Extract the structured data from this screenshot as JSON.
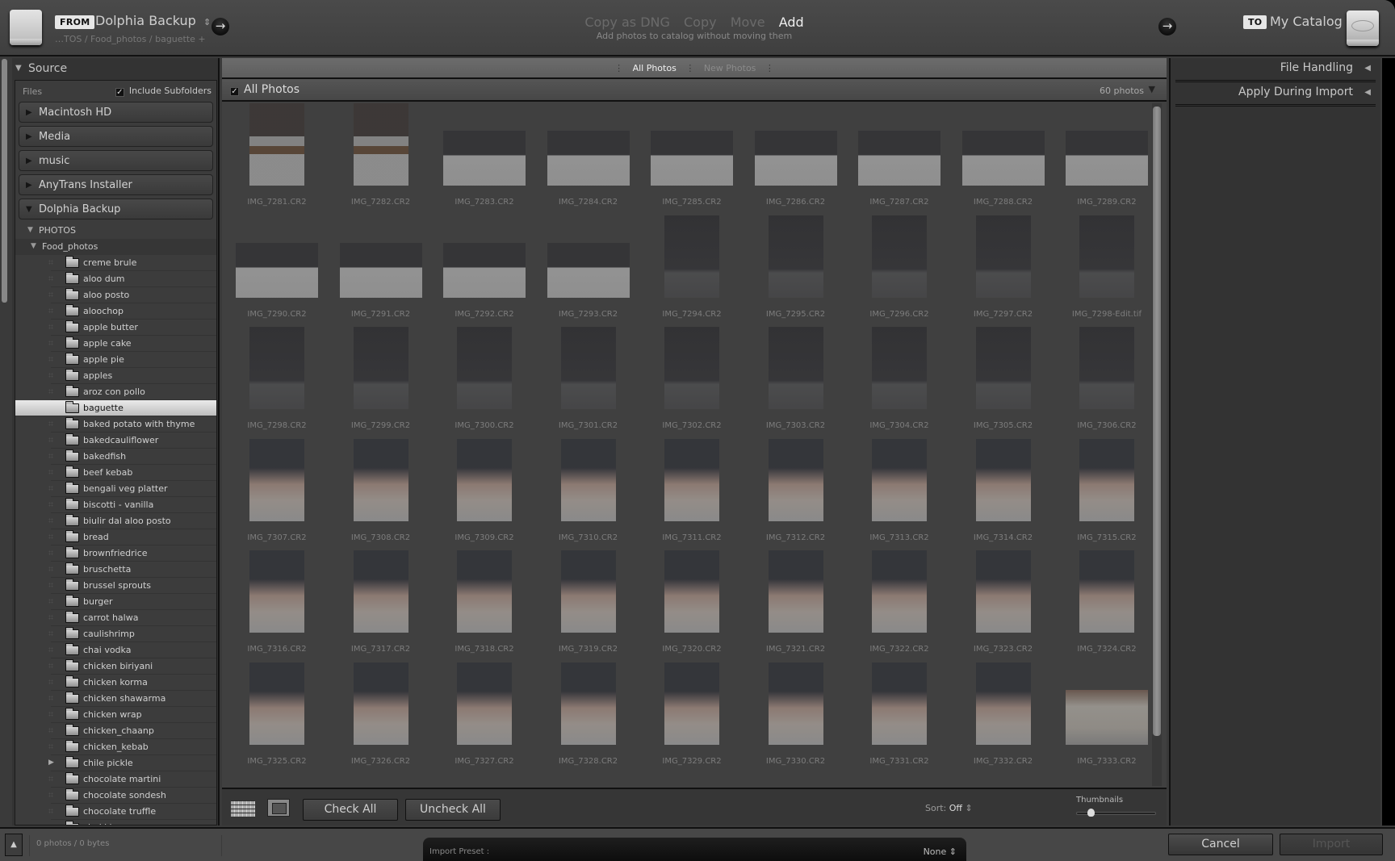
{
  "header": {
    "from_badge": "FROM",
    "source_name": "Dolphia Backup",
    "source_chevron": "⇕",
    "source_path": "…TOS / Food_photos / baguette +",
    "arrow_glyph": "→",
    "modes": [
      {
        "label": "Copy as DNG",
        "active": false
      },
      {
        "label": "Copy",
        "active": false
      },
      {
        "label": "Move",
        "active": false
      },
      {
        "label": "Add",
        "active": true
      }
    ],
    "mode_description": "Add photos to catalog without moving them",
    "to_badge": "TO",
    "destination_name": "My Catalog"
  },
  "source_panel": {
    "title": "Source",
    "files_label": "Files",
    "include_subfolders_label": "Include Subfolders",
    "include_subfolders_checked": true,
    "volumes": [
      {
        "name": "Macintosh HD",
        "expanded": false
      },
      {
        "name": "Media",
        "expanded": false
      },
      {
        "name": "music",
        "expanded": false
      },
      {
        "name": "AnyTrans Installer",
        "expanded": false
      },
      {
        "name": "Dolphia Backup",
        "expanded": true
      }
    ],
    "photos_folder": "PHOTOS",
    "food_folder": "Food_photos",
    "folders": [
      " creme brule",
      "aloo dum",
      "aloo posto",
      "aloochop",
      "apple butter",
      "apple cake",
      "apple pie",
      "apples",
      "aroz con pollo",
      "baguette",
      "baked potato with thyme",
      "bakedcauliflower",
      "bakedfish",
      "beef kebab",
      "bengali veg platter",
      "biscotti - vanilla",
      "biulir dal aloo posto",
      "bread",
      "brownfriedrice",
      "bruschetta",
      "brussel sprouts",
      "burger",
      "carrot halwa",
      "caulishrimp",
      "chai vodka",
      "chicken biriyani",
      "chicken korma",
      "chicken shawarma",
      "chicken wrap",
      "chicken_chaanp",
      "chicken_kebab",
      "chile pickle",
      "chocolate martini",
      "chocolate sondesh",
      "chocolate truffle",
      "chakkha"
    ],
    "selected_folder": "baguette",
    "expandable_folder": "chile pickle"
  },
  "grid": {
    "filters": [
      {
        "label": "All Photos",
        "active": true
      },
      {
        "label": "New Photos",
        "active": false
      }
    ],
    "section_title": "All Photos",
    "section_checked": true,
    "photo_count": "60 photos",
    "photos": [
      {
        "name": "IMG_7281.CR2",
        "orient": "portrait",
        "tone": "bowl"
      },
      {
        "name": "IMG_7282.CR2",
        "orient": "portrait",
        "tone": "bowl"
      },
      {
        "name": "IMG_7283.CR2",
        "orient": "landscape",
        "tone": "table"
      },
      {
        "name": "IMG_7284.CR2",
        "orient": "landscape",
        "tone": "table"
      },
      {
        "name": "IMG_7285.CR2",
        "orient": "landscape",
        "tone": "table"
      },
      {
        "name": "IMG_7286.CR2",
        "orient": "landscape",
        "tone": "table"
      },
      {
        "name": "IMG_7287.CR2",
        "orient": "landscape",
        "tone": "table"
      },
      {
        "name": "IMG_7288.CR2",
        "orient": "landscape",
        "tone": "table"
      },
      {
        "name": "IMG_7289.CR2",
        "orient": "landscape",
        "tone": "table"
      },
      {
        "name": "IMG_7290.CR2",
        "orient": "landscape",
        "tone": "table"
      },
      {
        "name": "IMG_7291.CR2",
        "orient": "landscape",
        "tone": "table"
      },
      {
        "name": "IMG_7292.CR2",
        "orient": "landscape",
        "tone": "table"
      },
      {
        "name": "IMG_7293.CR2",
        "orient": "landscape",
        "tone": "table"
      },
      {
        "name": "IMG_7294.CR2",
        "orient": "portrait",
        "tone": "dark"
      },
      {
        "name": "IMG_7295.CR2",
        "orient": "portrait",
        "tone": "dark"
      },
      {
        "name": "IMG_7296.CR2",
        "orient": "portrait",
        "tone": "dark"
      },
      {
        "name": "IMG_7297.CR2",
        "orient": "portrait",
        "tone": "dark"
      },
      {
        "name": "IMG_7298-Edit.tif",
        "orient": "portrait",
        "tone": "dark"
      },
      {
        "name": "IMG_7298.CR2",
        "orient": "portrait",
        "tone": "dark"
      },
      {
        "name": "IMG_7299.CR2",
        "orient": "portrait",
        "tone": "dark"
      },
      {
        "name": "IMG_7300.CR2",
        "orient": "portrait",
        "tone": "dark"
      },
      {
        "name": "IMG_7301.CR2",
        "orient": "portrait",
        "tone": "dark"
      },
      {
        "name": "IMG_7302.CR2",
        "orient": "portrait",
        "tone": "dark"
      },
      {
        "name": "IMG_7303.CR2",
        "orient": "portrait",
        "tone": "dark"
      },
      {
        "name": "IMG_7304.CR2",
        "orient": "portrait",
        "tone": "dark"
      },
      {
        "name": "IMG_7305.CR2",
        "orient": "portrait",
        "tone": "dark"
      },
      {
        "name": "IMG_7306.CR2",
        "orient": "portrait",
        "tone": "dark"
      },
      {
        "name": "IMG_7307.CR2",
        "orient": "portrait",
        "tone": "hands"
      },
      {
        "name": "IMG_7308.CR2",
        "orient": "portrait",
        "tone": "hands"
      },
      {
        "name": "IMG_7309.CR2",
        "orient": "portrait",
        "tone": "hands"
      },
      {
        "name": "IMG_7310.CR2",
        "orient": "portrait",
        "tone": "hands"
      },
      {
        "name": "IMG_7311.CR2",
        "orient": "portrait",
        "tone": "hands"
      },
      {
        "name": "IMG_7312.CR2",
        "orient": "portrait",
        "tone": "hands"
      },
      {
        "name": "IMG_7313.CR2",
        "orient": "portrait",
        "tone": "hands"
      },
      {
        "name": "IMG_7314.CR2",
        "orient": "portrait",
        "tone": "hands"
      },
      {
        "name": "IMG_7315.CR2",
        "orient": "portrait",
        "tone": "hands"
      },
      {
        "name": "IMG_7316.CR2",
        "orient": "portrait",
        "tone": "hands"
      },
      {
        "name": "IMG_7317.CR2",
        "orient": "portrait",
        "tone": "hands"
      },
      {
        "name": "IMG_7318.CR2",
        "orient": "portrait",
        "tone": "hands"
      },
      {
        "name": "IMG_7319.CR2",
        "orient": "portrait",
        "tone": "hands"
      },
      {
        "name": "IMG_7320.CR2",
        "orient": "portrait",
        "tone": "hands"
      },
      {
        "name": "IMG_7321.CR2",
        "orient": "portrait",
        "tone": "hands"
      },
      {
        "name": "IMG_7322.CR2",
        "orient": "portrait",
        "tone": "hands"
      },
      {
        "name": "IMG_7323.CR2",
        "orient": "portrait",
        "tone": "hands"
      },
      {
        "name": "IMG_7324.CR2",
        "orient": "portrait",
        "tone": "hands"
      },
      {
        "name": "IMG_7325.CR2",
        "orient": "portrait",
        "tone": "hands"
      },
      {
        "name": "IMG_7326.CR2",
        "orient": "portrait",
        "tone": "hands"
      },
      {
        "name": "IMG_7327.CR2",
        "orient": "portrait",
        "tone": "hands"
      },
      {
        "name": "IMG_7328.CR2",
        "orient": "portrait",
        "tone": "hands"
      },
      {
        "name": "IMG_7329.CR2",
        "orient": "portrait",
        "tone": "hands"
      },
      {
        "name": "IMG_7330.CR2",
        "orient": "portrait",
        "tone": "hands"
      },
      {
        "name": "IMG_7331.CR2",
        "orient": "portrait",
        "tone": "hands"
      },
      {
        "name": "IMG_7332.CR2",
        "orient": "portrait",
        "tone": "hands"
      },
      {
        "name": "IMG_7333.CR2",
        "orient": "landscape",
        "tone": "loaves"
      }
    ]
  },
  "toolbar": {
    "check_all": "Check All",
    "uncheck_all": "Uncheck All",
    "sort_label": "Sort:",
    "sort_value": "Off",
    "sort_chevron": "⇕",
    "thumbnails_label": "Thumbnails",
    "thumbnail_size_fraction": 0.18
  },
  "right_panel": {
    "sections": [
      {
        "label": "File Handling",
        "collapsed": true
      },
      {
        "label": "Apply During Import",
        "collapsed": true
      }
    ]
  },
  "bottom": {
    "status": "0 photos / 0 bytes",
    "preset_label": "Import Preset :",
    "preset_value": "None",
    "preset_chevron": "⇕",
    "cancel": "Cancel",
    "import": "Import"
  }
}
